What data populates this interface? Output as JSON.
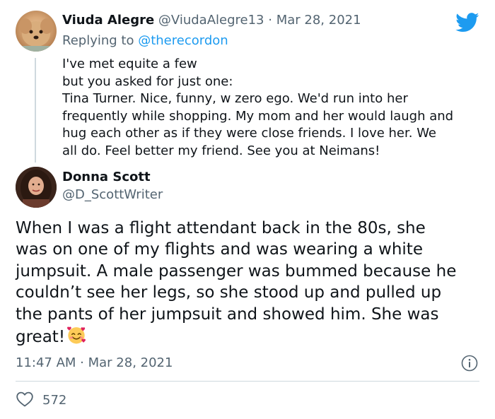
{
  "reply_tweet": {
    "name": "Viuda Alegre",
    "handle": "@ViudaAlegre13",
    "separator": "·",
    "date": "Mar 28, 2021",
    "replying_label": "Replying to",
    "replying_handle": "@therecordon",
    "lines": [
      "I've met equite a few",
      "but you asked for just one:",
      "Tina Turner. Nice, funny, w zero ego. We'd run into her",
      "frequently while shopping. My mom and her would laugh and",
      "hug each other as if they were close friends.  I love her. We",
      "all do. Feel better my friend. See you at Neimans!"
    ]
  },
  "main_tweet": {
    "name": "Donna Scott",
    "handle": "@D_ScottWriter",
    "lines": [
      "When I was a flight attendant back in the 80s, she",
      "was on one of my flights and was wearing a white",
      "jumpsuit. A male passenger was bummed because he",
      "couldn’t see her legs, so she stood up and pulled up",
      "the pants of her jumpsuit and showed him. She was",
      "great!"
    ],
    "emoji": "smiling-face-with-hearts",
    "timestamp": "11:47 AM · Mar 28, 2021",
    "like_count": "572"
  },
  "icons": {
    "brand": "twitter-bird-icon",
    "info": "info-icon",
    "like": "heart-icon"
  },
  "colors": {
    "twitter_blue": "#1d9bf0",
    "text": "#0f1419",
    "muted": "#536471",
    "divider": "#cfd9de"
  }
}
